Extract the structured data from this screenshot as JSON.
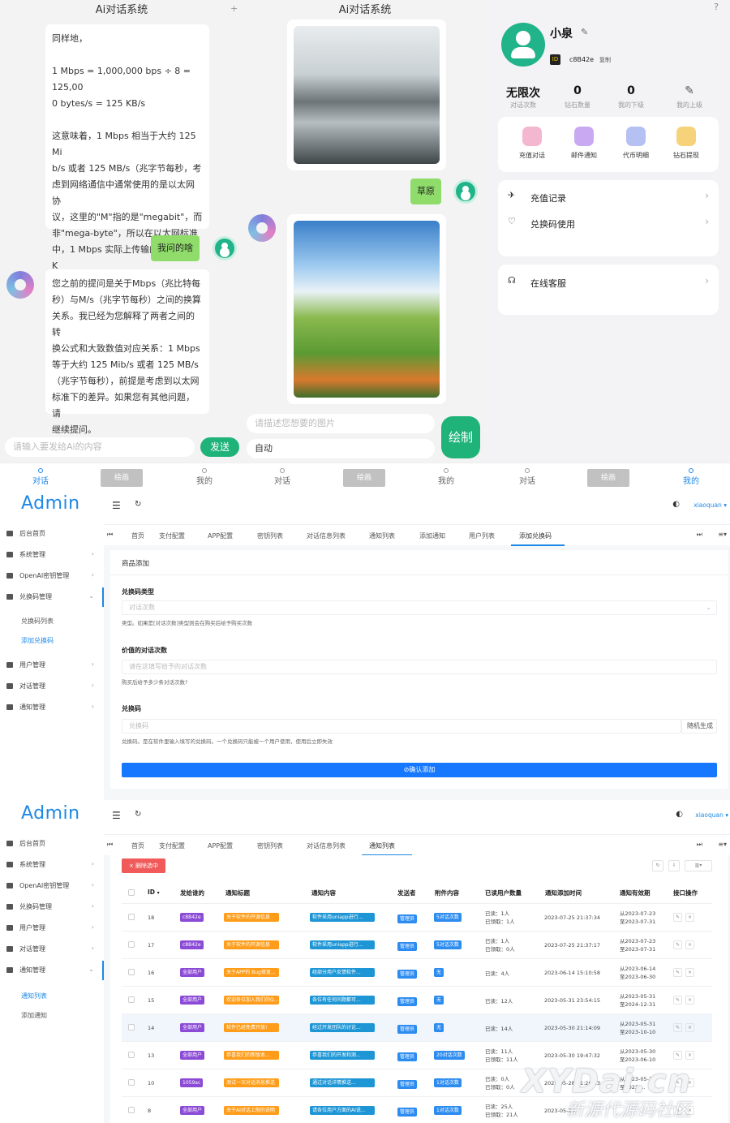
{
  "chat_left": {
    "title": "Ai对话系统",
    "ai_msg_1": [
      "同样地，",
      "",
      "1 Mbps = 1,000,000 bps ÷ 8 = 125,00",
      "0 bytes/s = 125 KB/s",
      "",
      "这意味着，1 Mbps 相当于大约 125 Mi",
      "b/s 或者 125 MB/s（兆字节每秒，考",
      "虑到网络通信中通常使用的是以太网协",
      "议，这里的\"M\"指的是\"megabit\"，而",
      "非\"mega-byte\"，所以在以太网标准",
      "中，1 Mbps 实际上传输的是约 125 K",
      "Bytes/s）。"
    ],
    "user_msg": "我问的啥",
    "ai_msg_2": [
      "您之前的提问是关于Mbps（兆比特每",
      "秒）与M/s（兆字节每秒）之间的换算",
      "关系。我已经为您解释了两者之间的转",
      "换公式和大致数值对应关系：1 Mbps",
      "等于大约 125 Mib/s 或者 125 MB/s",
      "（兆字节每秒），前提是考虑到以太网",
      "标准下的差异。如果您有其他问题，请",
      "继续提问。"
    ],
    "input_placeholder": "请输入要发给Ai的内容",
    "send": "发送"
  },
  "chat_right": {
    "title": "Ai对话系统",
    "plus": "+",
    "user_msg": "草原",
    "prompt_placeholder": "请描述您想要的图片",
    "mode": "自动",
    "draw": "绘制"
  },
  "profile": {
    "help": "?",
    "name": "小泉",
    "id_badge": "ID",
    "id_value": "c8B42e",
    "copy": "复制",
    "stats": [
      {
        "num": "无限次",
        "label": "对话次数"
      },
      {
        "num": "0",
        "label": "钻石数量"
      },
      {
        "num": "0",
        "label": "我的下级"
      },
      {
        "num": "",
        "label": "我的上级"
      }
    ],
    "tiles": [
      "充值对话",
      "邮件通知",
      "代币明细",
      "钻石提现"
    ],
    "rows": [
      "充值记录",
      "兑换码使用"
    ],
    "service": "在线客服"
  },
  "tabbar": {
    "items": [
      "对话",
      "我的",
      "对话",
      "我的",
      "对话",
      "我的"
    ],
    "ghost": "绘画"
  },
  "admin1": {
    "logo": "Admin",
    "user": "xiaoquan",
    "menu": [
      "后台首页",
      "系统管理",
      "OpenAI密钥管理",
      "兑换码管理",
      "用户管理",
      "对话管理",
      "通知管理"
    ],
    "submenu": [
      "兑换码列表",
      "添加兑换码"
    ],
    "tabs": [
      "首页",
      "支付配置",
      "APP配置",
      "密钥列表",
      "对话信息列表",
      "通知列表",
      "添加通知",
      "用户列表",
      "添加兑换码"
    ],
    "card_title": "商品添加",
    "f1_label": "兑换码类型",
    "f1_value": "对话次数",
    "f1_hint": "类型。如果是[对话次数]类型则会在购买后给予购买次数",
    "f2_label": "价值的对话次数",
    "f2_placeholder": "请在这填写给予的对话次数",
    "f2_hint": "购买后给予多少条对话次数?",
    "f3_label": "兑换码",
    "f3_placeholder": "兑换码",
    "f3_random": "随机生成",
    "f3_hint": "兑换码。是在软件里输入填写的兑换码。一个兑换码只能被一个用户使用，使用后立即失效",
    "submit": "⊘确认添加"
  },
  "admin2": {
    "logo": "Admin",
    "user": "xiaoquan",
    "menu": [
      "后台首页",
      "系统管理",
      "OpenAI密钥管理",
      "兑换码管理",
      "用户管理",
      "对话管理",
      "通知管理"
    ],
    "submenu": [
      "通知列表",
      "添加通知"
    ],
    "tabs": [
      "首页",
      "支付配置",
      "APP配置",
      "密钥列表",
      "对话信息列表",
      "通知列表"
    ],
    "delete_btn": "× 删除选中",
    "columns": [
      "ID",
      "发给谁的",
      "通知标题",
      "通知内容",
      "发送者",
      "附件内容",
      "已读用户数量",
      "通知添加时间",
      "通知有效期",
      "接口操作"
    ],
    "rows": [
      {
        "id": "18",
        "to": "c8B42e",
        "title": "关于软件的开源信息",
        "content": "软件采用uniapp进行...",
        "sender": "管理员",
        "attach": "5对话次数",
        "read": "已读：1人",
        "claim": "已领取：1人",
        "time": "2023-07-25 21:37:34",
        "from": "从2023-07-23",
        "until": "至2023-07-31"
      },
      {
        "id": "17",
        "to": "c8B42e",
        "title": "关于软件的开源信息",
        "content": "软件采用uniapp进行...",
        "sender": "管理员",
        "attach": "5对话次数",
        "read": "已读：1人",
        "claim": "已领取：0人",
        "time": "2023-07-25 21:37:17",
        "from": "从2023-07-23",
        "until": "至2023-07-31"
      },
      {
        "id": "16",
        "to": "全部用户",
        "title": "关于APP的 Bug修复...",
        "content": "经部分用户反馈软件...",
        "sender": "管理员",
        "attach": "无",
        "read": "已读：4人",
        "claim": "",
        "time": "2023-06-14 15:10:58",
        "from": "从2023-06-14",
        "until": "至2023-06-30"
      },
      {
        "id": "15",
        "to": "全部用户",
        "title": "欢迎各位加入我们的Q...",
        "content": "各位有任何问题都可...",
        "sender": "管理员",
        "attach": "无",
        "read": "已读：12人",
        "claim": "",
        "time": "2023-05-31 23:54:15",
        "from": "从2023-05-31",
        "until": "至2024-12-31"
      },
      {
        "id": "14",
        "to": "全部用户",
        "title": "软件已经免费开放!",
        "content": "经过开发团队的讨论...",
        "sender": "管理员",
        "attach": "无",
        "read": "已读：14人",
        "claim": "",
        "time": "2023-05-30 21:14:09",
        "from": "从2023-05-31",
        "until": "至2023-10-10"
      },
      {
        "id": "13",
        "to": "全部用户",
        "title": "恭喜我们的新版本...",
        "content": "恭喜我们的开发和测...",
        "sender": "管理员",
        "attach": "20对话次数",
        "read": "已读：11人",
        "claim": "已领取：11人",
        "time": "2023-05-30 19:47:32",
        "from": "从2023-05-30",
        "until": "至2023-06-10"
      },
      {
        "id": "10",
        "to": "1059ac",
        "title": "测试一次对话消息推送",
        "content": "通过对话详情推送...",
        "sender": "管理员",
        "attach": "1对话次数",
        "read": "已读：0人",
        "claim": "已领取：0人",
        "time": "2023-05-28 11:26:13",
        "from": "从2023-05-28",
        "until": "至2023-..."
      },
      {
        "id": "8",
        "to": "全部用户",
        "title": "关于AI对话上限的说明",
        "content": "请各位用户方面的AI说...",
        "sender": "管理员",
        "attach": "1对话次数",
        "read": "已读：25人",
        "claim": "已领取：21人",
        "time": "2023-05-28",
        "from": "",
        "until": ""
      }
    ]
  },
  "watermark": {
    "line1": "XYDai.cn",
    "line2": "新源代源码社区"
  },
  "colors": {
    "accent": "#1677ff",
    "green": "#1fb37a",
    "bubble": "#8fdc6a"
  }
}
